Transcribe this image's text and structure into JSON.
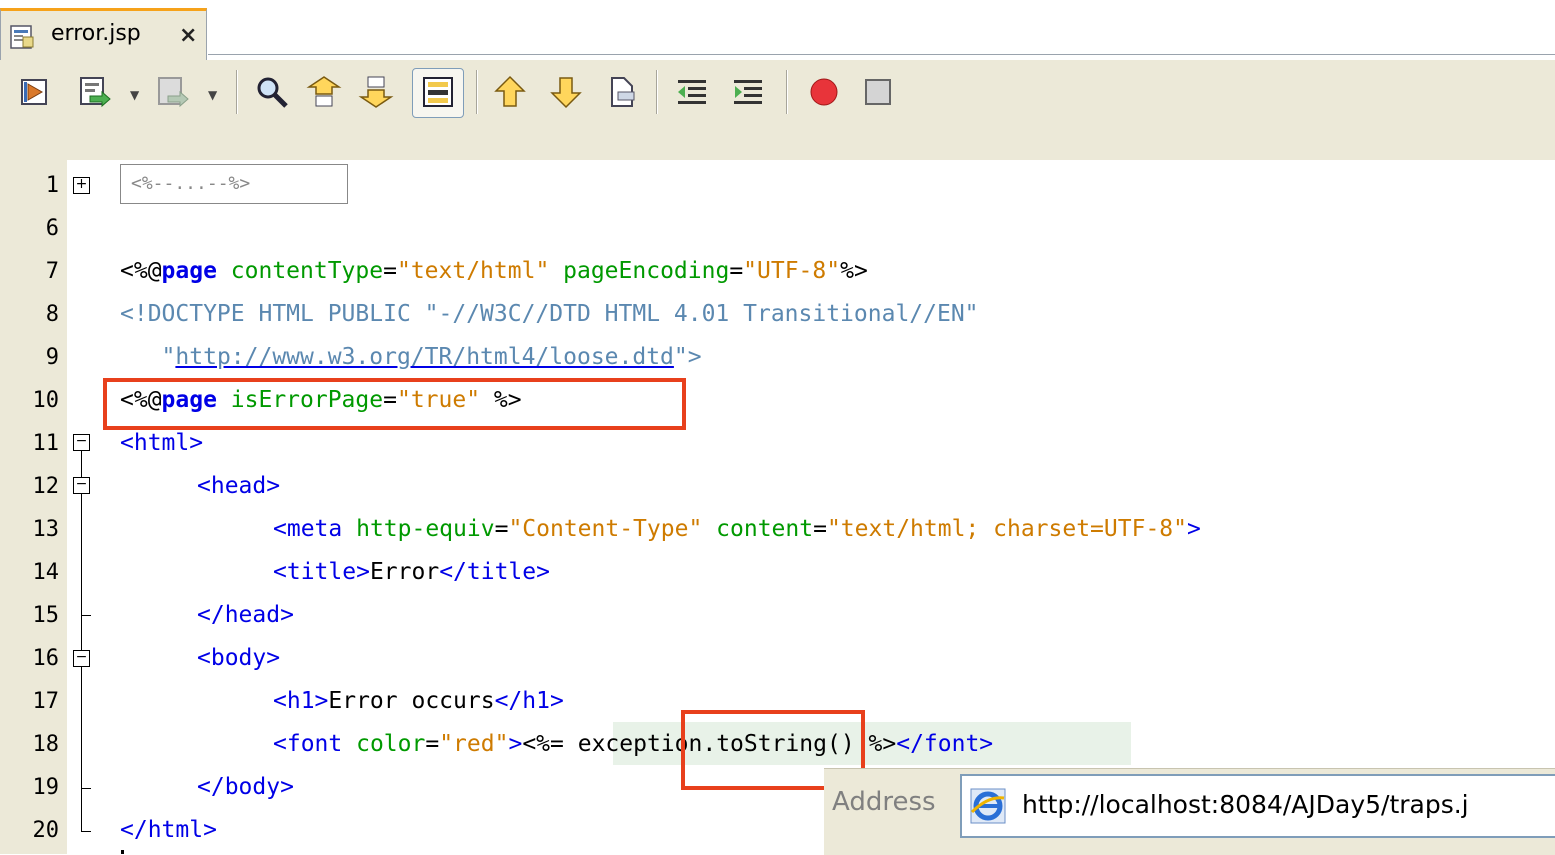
{
  "tab": {
    "label": "error.jsp",
    "close": "×"
  },
  "toolbar": {
    "icons": [
      "last-edit-icon",
      "back-history-icon",
      "forward-history-icon",
      "find-icon",
      "find-previous-icon",
      "find-next-icon",
      "toggle-highlight-icon",
      "previous-bookmark-icon",
      "next-bookmark-icon",
      "toggle-bookmark-icon",
      "shift-left-icon",
      "shift-right-icon",
      "start-macro-icon",
      "stop-macro-icon"
    ]
  },
  "editor": {
    "collapsed_comment": "<%--...--%>",
    "line_numbers": [
      "1",
      "6",
      "7",
      "8",
      "9",
      "10",
      "11",
      "12",
      "13",
      "14",
      "15",
      "16",
      "17",
      "18",
      "19",
      "20"
    ],
    "lines": {
      "l7": [
        "<%@",
        "page",
        " contentType",
        "=",
        "\"text/html\"",
        " pageEncoding",
        "=",
        "\"UTF-8\"",
        "%>"
      ],
      "l8": "<!DOCTYPE HTML PUBLIC \"-//W3C//DTD HTML 4.01 Transitional//EN\"",
      "l9": [
        "\"",
        "http://www.w3.org/TR/html4/loose.dtd",
        "\">"
      ],
      "l10": [
        "<%@",
        "page",
        " isErrorPage",
        "=",
        "\"true\"",
        " %>"
      ],
      "l11": "<html>",
      "l12": "<head>",
      "l13": [
        "<meta",
        " http-equiv",
        "=",
        "\"Content-Type\"",
        " content",
        "=",
        "\"text/html; charset=UTF-8\"",
        ">"
      ],
      "l14": [
        "<title>",
        "Error",
        "</title>"
      ],
      "l15": "</head>",
      "l16": "<body>",
      "l17": [
        "<h1>",
        "Error occurs",
        "</h1>"
      ],
      "l18": [
        "<font",
        " color",
        "=",
        "\"red\"",
        ">",
        "<%=",
        "exception.toString() ",
        "%>",
        "</font>"
      ],
      "l19": "</body>",
      "l20": "</html>"
    }
  },
  "browser": {
    "address_label": "Address",
    "url": "http://localhost:8084/AJDay5/traps.j"
  },
  "colors": {
    "highlight_border": "#e8401c",
    "keyword": "#0000e6",
    "attribute": "#009900",
    "string": "#ce7b00"
  }
}
